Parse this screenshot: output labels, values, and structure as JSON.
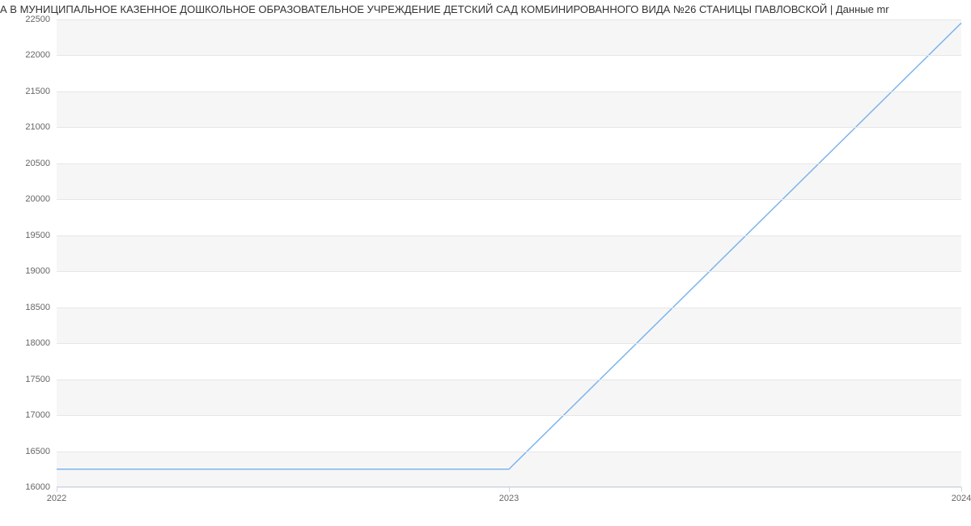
{
  "title": "А В МУНИЦИПАЛЬНОЕ КАЗЕННОЕ ДОШКОЛЬНОЕ ОБРАЗОВАТЕЛЬНОЕ УЧРЕЖДЕНИЕ ДЕТСКИЙ САД КОМБИНИРОВАННОГО ВИДА №26 СТАНИЦЫ ПАВЛОВСКОЙ | Данные mr",
  "chart_data": {
    "type": "line",
    "x": [
      2022,
      2023,
      2024
    ],
    "values": [
      16250,
      16250,
      22450
    ],
    "xlabel": "",
    "ylabel": "",
    "xlim": [
      2022,
      2024
    ],
    "ylim": [
      16000,
      22500
    ],
    "y_ticks": [
      16000,
      16500,
      17000,
      17500,
      18000,
      18500,
      19000,
      19500,
      20000,
      20500,
      21000,
      21500,
      22000,
      22500
    ],
    "x_ticks": [
      2022,
      2023,
      2024
    ],
    "line_color": "#7cb5ec"
  }
}
